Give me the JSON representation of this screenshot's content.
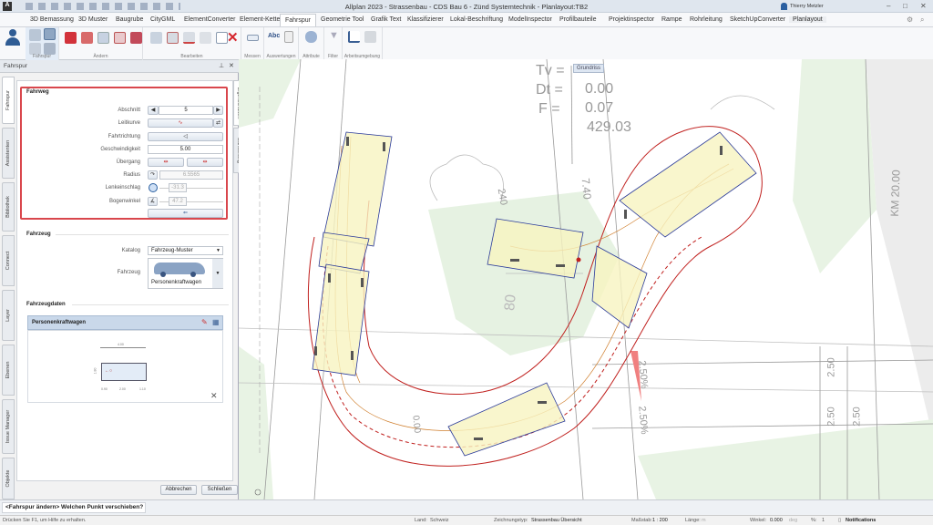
{
  "window": {
    "title": "Allplan 2023 - Strassenbau - CDS Bau 6 - Zünd Systemtechnik - Planlayout:TB2",
    "user": "Thierry Metzler"
  },
  "ribbon": {
    "tabs": [
      "3D Bemassung",
      "3D Muster",
      "Baugrube",
      "CityGML",
      "ElementConverter",
      "Element-Kette",
      "Fahrspur",
      "Geometrie Tool",
      "Grafik Text",
      "Klassifizierer",
      "Lokal-Beschriftung",
      "ModelInspector",
      "Profilbauteile",
      "Projektinspector",
      "Rampe",
      "Rohrleitung",
      "SketchUpConverter",
      "Planlayout"
    ],
    "active_tab": "Fahrspur",
    "groups": [
      "Fahrspur",
      "Ändern",
      "Bearbeiten",
      "Messen",
      "Auswertungen",
      "Attribute",
      "Filter",
      "Arbeitsumgebung"
    ],
    "abc_label": "Abc"
  },
  "panel": {
    "title": "Fahrspur",
    "left_tabs": [
      "Fahrspur",
      "Assistenten",
      "Bibliothek",
      "Connect",
      "Layer",
      "Ebenen",
      "Issue Manager",
      "Objekte"
    ],
    "right_tabs": [
      "Eigenschaften",
      "Darstellung"
    ],
    "fahrweg": {
      "title": "Fahrweg",
      "abschnitt_label": "Abschnitt",
      "abschnitt_value": "5",
      "leitkurve_label": "Leitkurve",
      "fahrtrichtung_label": "Fahrtrichtung",
      "geschwindigkeit_label": "Geschwindigkeit",
      "geschwindigkeit_value": "5.00",
      "uebergang_label": "Übergang",
      "radius_label": "Radius",
      "radius_value": "6.5565",
      "lenkeinschlag_label": "Lenkeinschlag",
      "lenkeinschlag_value": "-31.3",
      "bogenwinkel_label": "Bogenwinkel",
      "bogenwinkel_value": "47.2"
    },
    "fahrzeug": {
      "title": "Fahrzeug",
      "katalog_label": "Katalog",
      "katalog_value": "Fahrzeug-Muster",
      "fahrzeug_label": "Fahrzeug",
      "fahrzeug_value": "Personenkraftwagen"
    },
    "fahrzeugdaten": {
      "title": "Fahrzeugdaten",
      "vehicle_name": "Personenkraftwagen",
      "dims": {
        "length": "4.00",
        "width": "1.80",
        "front": "0.90",
        "wheelbase": "2.00",
        "rear": "1.10"
      }
    },
    "buttons": {
      "cancel": "Abbrechen",
      "close": "Schließen"
    }
  },
  "canvas": {
    "view_label": "Grundriss",
    "labels": {
      "tv": "Tv =",
      "dt": "Dt =",
      "f": "F =",
      "dt_value": "0.00",
      "f_value": "0.07",
      "elev": "429.03",
      "dim1": "7.40",
      "km": "KM 20.00",
      "slope1": "2.50%",
      "slope2": "2.50%",
      "w1": "2.50",
      "w2": "2.50",
      "w3": "2.50",
      "z1": "0.00",
      "misc1": "80",
      "misc2": "240"
    }
  },
  "command": {
    "prompt": "<Fahrspur ändern> Welchen Punkt verschieben?"
  },
  "status": {
    "help": "Drücken Sie F1, um Hilfe zu erhalten.",
    "land_label": "Land:",
    "land": "Schweiz",
    "zeichnungstyp_label": "Zeichnungstyp:",
    "zeichnungstyp": "Strassenbau Übersicht",
    "massstab_label": "Maßstab:",
    "massstab": "1 : 200",
    "laenge_label": "Länge:",
    "laenge_unit": "m",
    "winkel_label": "Winkel:",
    "winkel": "0.000",
    "winkel_unit": "deg",
    "percent_label": "%:",
    "percent": "1",
    "notifications": "Notifications"
  },
  "colors": {
    "accent_red": "#c8252c",
    "vehicle_outline": "#2a3a9a",
    "vehicle_fill": "#f8f4c0",
    "path_red": "#c0201e",
    "green_area": "#e8f3e4"
  }
}
